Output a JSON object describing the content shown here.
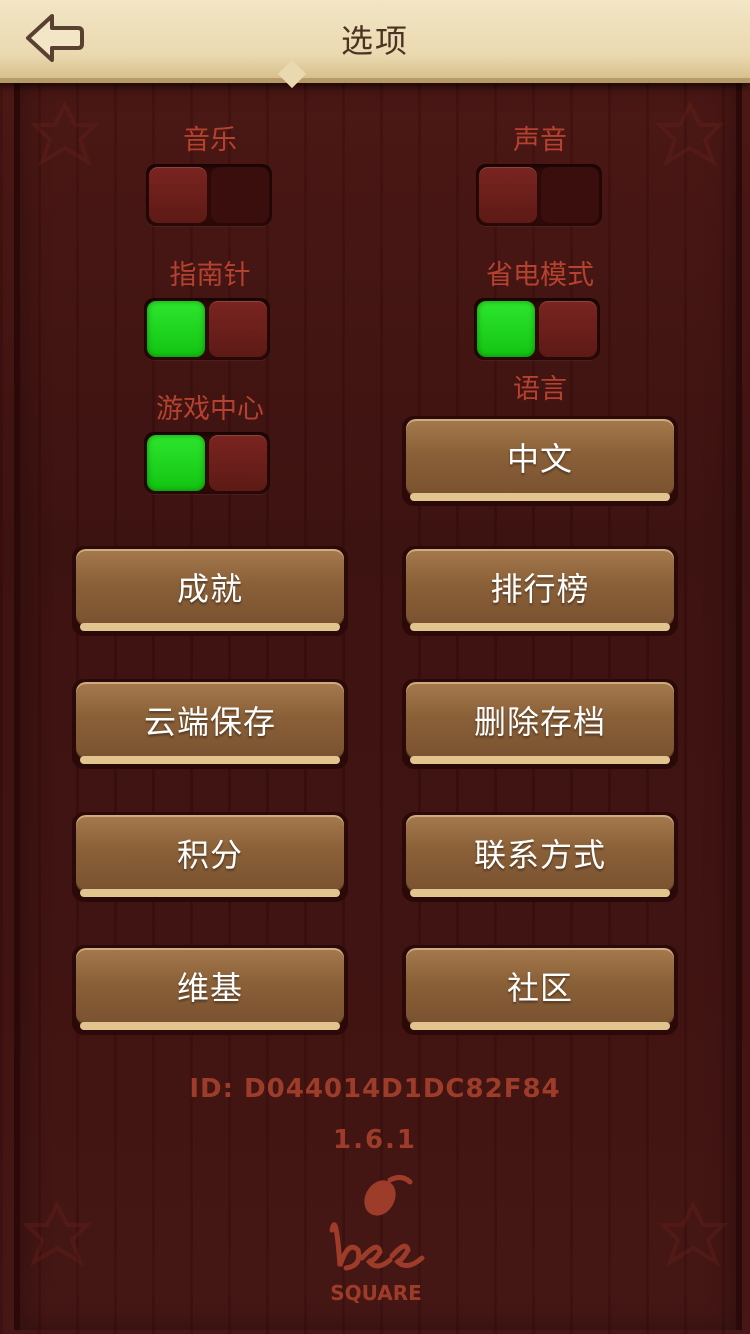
{
  "header": {
    "title": "选项",
    "back_icon": "back-arrow-icon"
  },
  "settings": {
    "music": {
      "label": "音乐",
      "state": "off"
    },
    "sound": {
      "label": "声音",
      "state": "off"
    },
    "compass": {
      "label": "指南针",
      "state": "on"
    },
    "power_saving": {
      "label": "省电模式",
      "state": "on"
    },
    "game_center": {
      "label": "游戏中心",
      "state": "on"
    },
    "language": {
      "label": "语言",
      "value": "中文"
    }
  },
  "buttons": {
    "achievements": "成就",
    "leaderboard": "排行榜",
    "cloud_save": "云端保存",
    "delete_save": "删除存档",
    "points": "积分",
    "contact": "联系方式",
    "wiki": "维基",
    "community": "社区"
  },
  "footer": {
    "id": "ID: D044014D1DC82F84",
    "version": "1.6.1",
    "logo_text": "SQUARE",
    "logo_script": "bee"
  },
  "colors": {
    "background": "#3a0f0d",
    "label": "#b5412f",
    "toggle_on": "#1fd41f",
    "toggle_off": "#6b1f1b",
    "button_face": "#8a6038",
    "header": "#ead9b0"
  }
}
